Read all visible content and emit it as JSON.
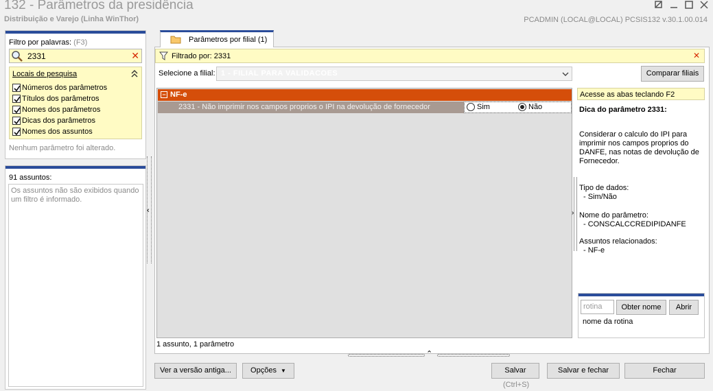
{
  "window": {
    "title": "132 - Parâmetros da presidência",
    "subtitle": "Distribuição e Varejo (Linha WinThor)",
    "user_info": "PCADMIN (LOCAL@LOCAL)   PCSIS132  v.30.1.00.014"
  },
  "filter": {
    "label": "Filtro por palavras:",
    "shortcut": "(F3)",
    "search_value": "2331",
    "clear_icon": "close-x-icon"
  },
  "locations": {
    "title": "Locais de pesquisa",
    "items": [
      {
        "label": "Números dos parâmetros",
        "checked": true
      },
      {
        "label": "Títulos dos parâmetros",
        "checked": true
      },
      {
        "label": "Nomes dos parâmetros",
        "checked": true
      },
      {
        "label": "Dicas dos parâmetros",
        "checked": true
      },
      {
        "label": "Nomes dos assuntos",
        "checked": true
      }
    ],
    "no_change_text": "Nenhum parâmetro foi alterado."
  },
  "subjects": {
    "count_label": "91 assuntos:",
    "message": "Os assuntos não são exibidos quando um filtro é informado."
  },
  "tab": {
    "label": "Parâmetros por filial",
    "count": "(1)"
  },
  "filter_strip": {
    "text": "Filtrado por: 2331"
  },
  "branch": {
    "label": "Selecione a filial:",
    "value": "1 - FILIAL PARA VALIDACOES"
  },
  "compare_button": "Comparar filiais",
  "grid": {
    "group_title": "NF-e",
    "toggle": "−",
    "row_text": "2331 - Não imprimir nos campos proprios o IPI na devolução de fornecedor",
    "options": [
      {
        "label": "Sim",
        "selected": false
      },
      {
        "label": "Não",
        "selected": true
      }
    ],
    "status": "1 assunto, 1 parâmetro"
  },
  "tip": {
    "strip_text": "Acesse as abas teclando F2",
    "title": "Dica do parâmetro 2331:",
    "description": "Considerar o calculo do IPI para imprimir nos campos proprios do DANFE, nas notas de devolução de Fornecedor.",
    "data_type_label": "Tipo de dados:",
    "data_type_value": "- Sim/Não",
    "param_name_label": "Nome do parâmetro:",
    "param_name_value": "- CONSCALCCREDIPIDANFE",
    "related_label": "Assuntos relacionados:",
    "related_value": "- NF-e"
  },
  "rotina": {
    "placeholder": "rotina",
    "obter_label": "Obter nome",
    "abrir_label": "Abrir",
    "name_label": "nome da rotina"
  },
  "buttons": {
    "old_version": "Ver a versão antiga...",
    "options": "Opções",
    "save": "Salvar",
    "save_shortcut": "(Ctrl+S)",
    "save_close": "Salvar e fechar",
    "close": "Fechar"
  }
}
